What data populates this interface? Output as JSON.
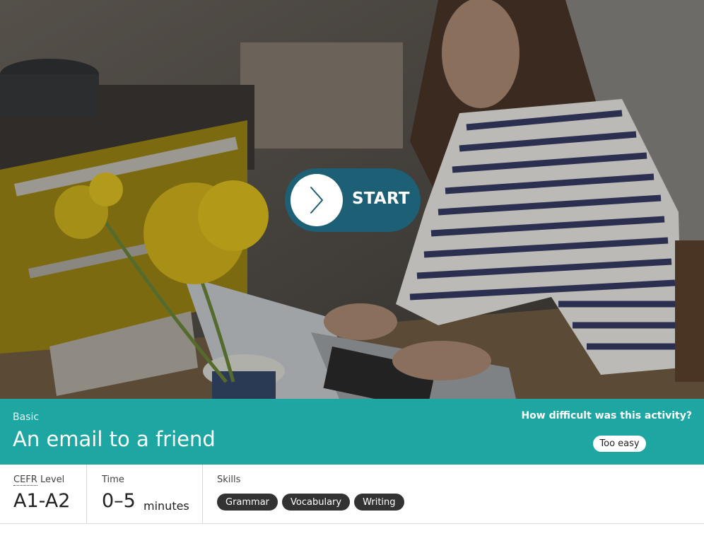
{
  "hero": {
    "start_label": "START"
  },
  "activity": {
    "level_tag": "Basic",
    "title": "An email to a friend"
  },
  "feedback": {
    "question": "How difficult was this activity?",
    "selected_option": "Too easy"
  },
  "details": {
    "level_label_abbr": "CEFR",
    "level_label_rest": " Level",
    "level_value": "A1-A2",
    "time_label": "Time",
    "time_value": "0–5",
    "time_unit": "minutes",
    "skills_label": "Skills",
    "skills": [
      "Grammar",
      "Vocabulary",
      "Writing"
    ]
  },
  "colors": {
    "band": "#1ea6a3",
    "start_button": "#1d5f75",
    "chip": "#333333"
  },
  "icons": {
    "start": "chevron-right-icon"
  }
}
